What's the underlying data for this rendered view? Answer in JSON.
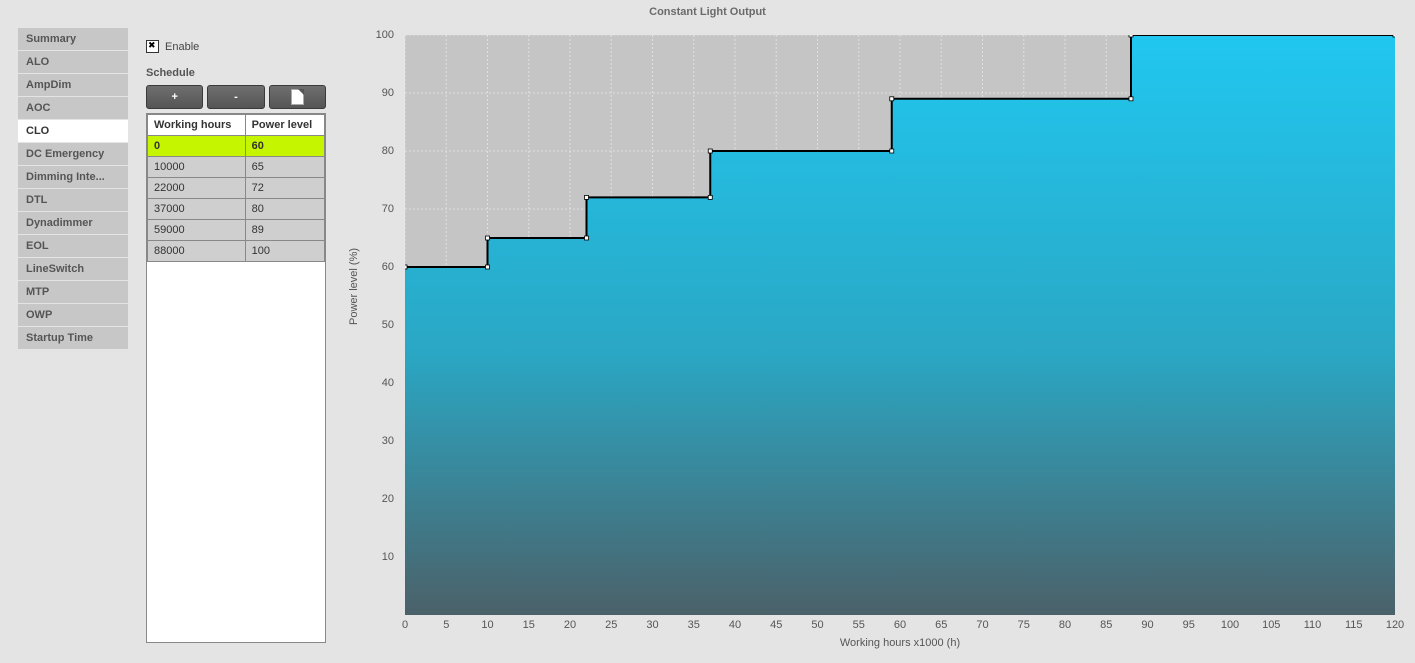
{
  "page_title": "Constant Light Output",
  "sidebar": {
    "items": [
      {
        "label": "Summary"
      },
      {
        "label": "ALO"
      },
      {
        "label": "AmpDim"
      },
      {
        "label": "AOC"
      },
      {
        "label": "CLO"
      },
      {
        "label": "DC Emergency"
      },
      {
        "label": "Dimming Inte..."
      },
      {
        "label": "DTL"
      },
      {
        "label": "Dynadimmer"
      },
      {
        "label": "EOL"
      },
      {
        "label": "LineSwitch"
      },
      {
        "label": "MTP"
      },
      {
        "label": "OWP"
      },
      {
        "label": "Startup Time"
      }
    ],
    "selected_index": 4
  },
  "config": {
    "enable_label": "Enable",
    "enable_checked": true,
    "schedule_label": "Schedule",
    "buttons": {
      "add": "+",
      "remove": "-",
      "new_doc": ""
    },
    "table_headers": {
      "hours": "Working hours",
      "level": "Power level"
    },
    "rows": [
      {
        "hours": "0",
        "level": "60",
        "highlight": true
      },
      {
        "hours": "10000",
        "level": "65"
      },
      {
        "hours": "22000",
        "level": "72"
      },
      {
        "hours": "37000",
        "level": "80"
      },
      {
        "hours": "59000",
        "level": "89"
      },
      {
        "hours": "88000",
        "level": "100"
      }
    ]
  },
  "chart_data": {
    "type": "area",
    "title": "Constant Light Output",
    "xlabel": "Working hours x1000 (h)",
    "ylabel": "Power level (%)",
    "xlim": [
      0,
      120
    ],
    "ylim": [
      0,
      100
    ],
    "x_ticks": [
      0,
      5,
      10,
      15,
      20,
      25,
      30,
      35,
      40,
      45,
      50,
      55,
      60,
      65,
      70,
      75,
      80,
      85,
      90,
      95,
      100,
      105,
      110,
      115,
      120
    ],
    "y_ticks": [
      10,
      20,
      30,
      40,
      50,
      60,
      70,
      80,
      90,
      100
    ],
    "step_points": [
      {
        "x": 0,
        "y": 60
      },
      {
        "x": 10,
        "y": 65
      },
      {
        "x": 22,
        "y": 72
      },
      {
        "x": 37,
        "y": 80
      },
      {
        "x": 59,
        "y": 89
      },
      {
        "x": 88,
        "y": 100
      }
    ],
    "x_end": 120
  }
}
